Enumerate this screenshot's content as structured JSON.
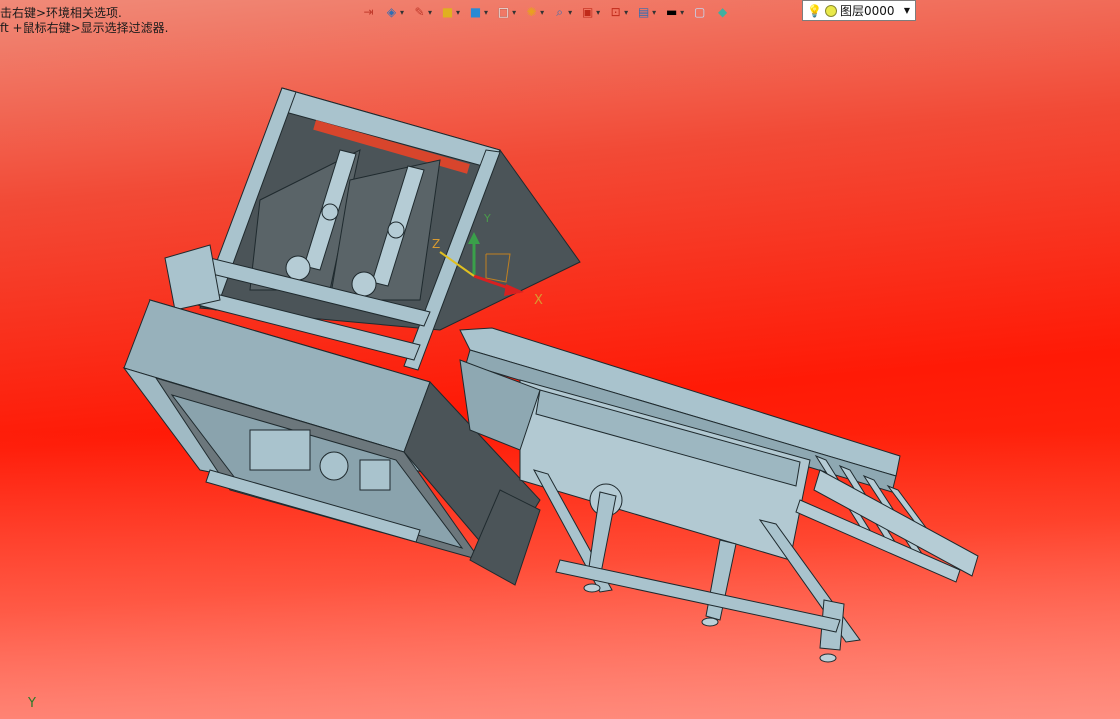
{
  "hints": {
    "line1": "击右键>环境相关选项.",
    "line2": "ft +鼠标右键>显示选择过滤器."
  },
  "toolbar": {
    "buttons": [
      {
        "name": "exit-sketch-icon",
        "glyph": "⇥",
        "color": "#c0392b"
      },
      {
        "name": "view-orient-icon",
        "glyph": "◈",
        "color": "#2e6db4"
      },
      {
        "name": "pen-icon",
        "glyph": "✎",
        "color": "#c0392b"
      },
      {
        "name": "box-yellow-icon",
        "glyph": "■",
        "color": "#e0b020"
      },
      {
        "name": "cube-blue-icon",
        "glyph": "■",
        "color": "#2a8ad4"
      },
      {
        "name": "cube-white-icon",
        "glyph": "□",
        "color": "#ffffff"
      },
      {
        "name": "color-wheel-icon",
        "glyph": "✺",
        "color": "#e8a020"
      },
      {
        "name": "zoom-icon",
        "glyph": "⌕",
        "color": "#3b6fb0"
      },
      {
        "name": "section-icon",
        "glyph": "▣",
        "color": "#c02a1a"
      },
      {
        "name": "clip-icon",
        "glyph": "⊡",
        "color": "#c02a1a"
      },
      {
        "name": "display-icon",
        "glyph": "▤",
        "color": "#2e6db4"
      },
      {
        "name": "black-rect-icon",
        "glyph": "▬",
        "color": "#000000"
      },
      {
        "name": "white-rect-icon",
        "glyph": "▢",
        "color": "#bfe0ff"
      },
      {
        "name": "surface-icon",
        "glyph": "◆",
        "color": "#3fb0a0"
      }
    ]
  },
  "layer": {
    "label": "图层0000"
  },
  "axes": {
    "x": "X",
    "y": "Y",
    "z": "Z",
    "corner_y": "Y"
  },
  "colors": {
    "metal": "#a9c3cd",
    "metal_dark": "#7c97a2",
    "panel": "#4b5458",
    "outline": "#1f2a2e"
  }
}
